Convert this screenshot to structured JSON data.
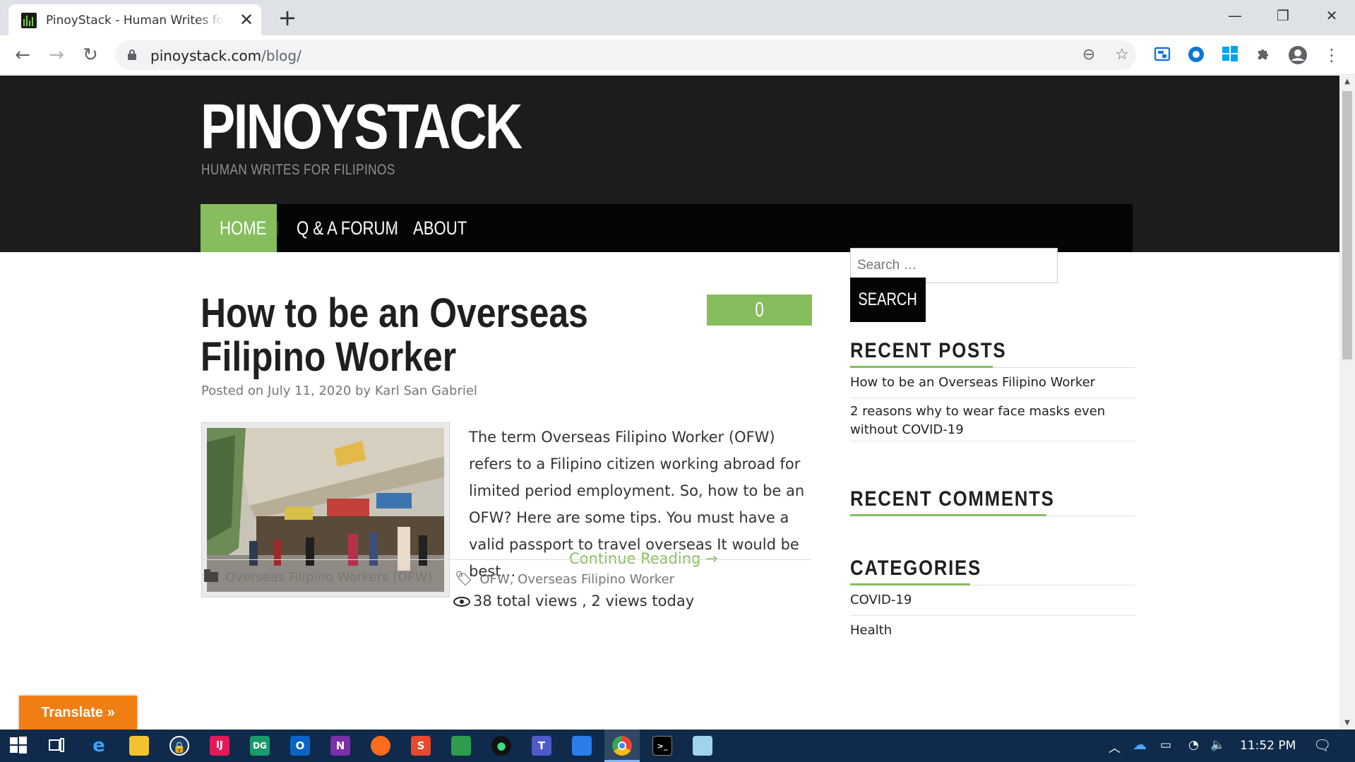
{
  "browser": {
    "tab_title": "PinoyStack - Human Writes for Filipinos",
    "tab_close": "✕",
    "new_tab": "+",
    "url_host": "pinoystack.com",
    "url_path": "/blog/",
    "window_controls": {
      "minimize": "—",
      "restore": "❐",
      "close": "✕"
    },
    "nav": {
      "back": "←",
      "forward": "→",
      "reload": "↻"
    },
    "omnibox_icons": {
      "zoom": "⊖",
      "bookmark": "☆"
    },
    "extensions": [
      "translate-ext-icon",
      "circle-ext-icon",
      "windows-ext-icon",
      "puzzle-icon",
      "profile-icon",
      "menu-kebab-icon"
    ]
  },
  "site": {
    "title": "PINOYSTACK",
    "tagline": "HUMAN WRITES FOR FILIPINOS",
    "nav": [
      {
        "label": "HOME",
        "active": true
      },
      {
        "label": "Q & A FORUM",
        "active": false
      },
      {
        "label": "ABOUT",
        "active": false
      }
    ]
  },
  "post": {
    "title": "How to be an Overseas Filipino Worker",
    "comments": "0 Comments",
    "meta_prefix": "Posted on ",
    "date": "July 11, 2020",
    "meta_by": " by ",
    "author": "Karl San Gabriel",
    "excerpt": "The term Overseas Filipino Worker (OFW) refers to a Filipino citizen working abroad for limited period employment. So, how to be an OFW? Here are some tips. You must have a valid passport to travel overseas It would be best…",
    "continue": "Continue Reading →",
    "views": "38 total views , 2 views today",
    "category": "Overseas Filipino Workers (OFW)",
    "tags": "OFW, Overseas Filipino Worker"
  },
  "sidebar": {
    "search_placeholder": "Search …",
    "search_button": "SEARCH",
    "recent_posts_title": "RECENT POSTS",
    "recent_posts": [
      "How to be an Overseas Filipino Worker",
      "2 reasons why to wear face masks even without COVID-19"
    ],
    "recent_comments_title": "RECENT COMMENTS",
    "categories_title": "CATEGORIES",
    "categories": [
      "COVID-19",
      "Health"
    ]
  },
  "translate_button": "Translate »",
  "taskbar": {
    "time": "11:52 PM"
  },
  "colors": {
    "accent_green": "#86be5d",
    "header_dark": "#1c1c1e",
    "translate_orange": "#f07e13",
    "taskbar": "#0f2a4a"
  }
}
